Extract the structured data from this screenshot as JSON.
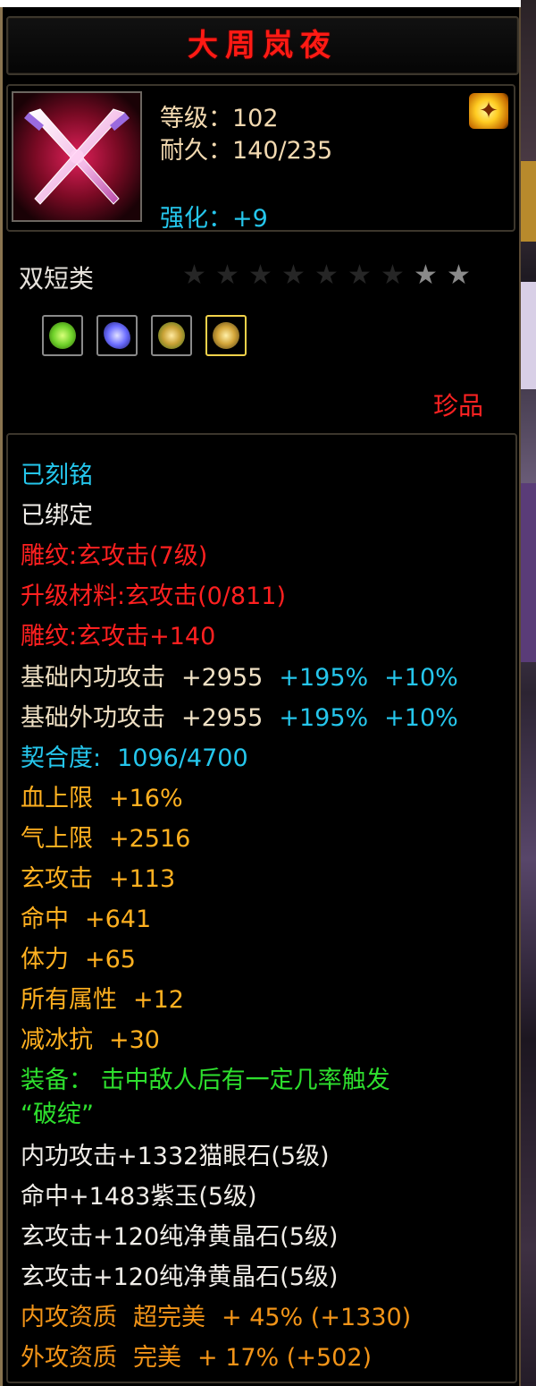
{
  "item": {
    "name": "大周岚夜",
    "level_line": "等级：102",
    "durability_line": "耐久：140/235",
    "enhance_line": "强化：+9",
    "category": "双短类",
    "quality": "珍品",
    "stars": {
      "total": 9,
      "filled": 2
    },
    "gems": [
      {
        "name": "gem-green-icon",
        "color": "#6fd22a"
      },
      {
        "name": "gem-blue-icon",
        "color": "#6a6cff"
      },
      {
        "name": "gem-gold-icon",
        "color": "#c9a236"
      },
      {
        "name": "gem-gold-selected-icon",
        "color": "#d4a63a"
      }
    ]
  },
  "colors": {
    "title": "#ff1a14",
    "cyan": "#25c6ec",
    "red": "#ff2020",
    "orange": "#ffb020",
    "green": "#2ee02e",
    "amber": "#f29418"
  },
  "attributes": {
    "engraved": "已刻铭",
    "bound": "已绑定",
    "carve1": "雕纹:玄攻击(7级)",
    "upgrade": "升级材料:玄攻击(0/811)",
    "carve2": "雕纹:玄攻击+140",
    "base_inner": {
      "label": "基础内功攻击",
      "value": "+2955",
      "pct1": "+195%",
      "pct2": "+10%"
    },
    "base_outer": {
      "label": "基础外功攻击",
      "value": "+2955",
      "pct1": "+195%",
      "pct2": "+10%"
    },
    "fit": {
      "label": "契合度:",
      "value": "1096/4700"
    },
    "bonuses": [
      {
        "label": "血上限",
        "value": "+16%"
      },
      {
        "label": "气上限",
        "value": "+2516"
      },
      {
        "label": "玄攻击",
        "value": "+113"
      },
      {
        "label": "命中",
        "value": "+641"
      },
      {
        "label": "体力",
        "value": "+65"
      },
      {
        "label": "所有属性",
        "value": "+12"
      },
      {
        "label": "减冰抗",
        "value": "+30"
      }
    ],
    "equip_effect_line1": "装备：  击中敌人后有一定几率触发",
    "equip_effect_line2": "“破绽”",
    "socket_lines": [
      "内功攻击+1332猫眼石(5级)",
      "命中+1483紫玉(5级)",
      "玄攻击+120纯净黄晶石(5级)",
      "玄攻击+120纯净黄晶石(5级)"
    ],
    "aptitude": [
      {
        "label": "内攻资质",
        "grade": "超完美",
        "value": "+ 45% (+1330)"
      },
      {
        "label": "外攻资质",
        "grade": "完美",
        "value": "+ 17% (+502)"
      }
    ]
  }
}
